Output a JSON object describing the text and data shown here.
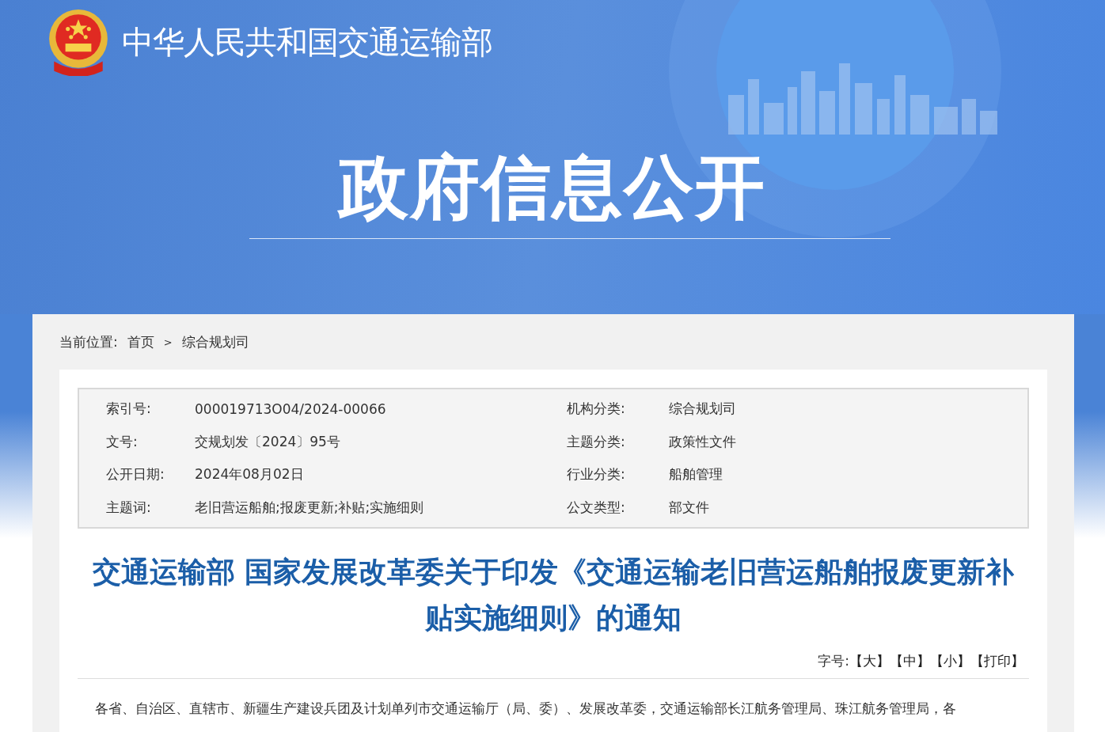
{
  "header": {
    "ministry": "中华人民共和国交通运输部",
    "banner_title": "政府信息公开"
  },
  "breadcrumb": {
    "label": "当前位置:",
    "items": [
      {
        "text": "首页"
      },
      {
        "text": "综合规划司"
      }
    ],
    "separator": ">"
  },
  "meta": [
    {
      "label": "索引号:",
      "value": "000019713O04/2024-00066"
    },
    {
      "label": "机构分类:",
      "value": "综合规划司"
    },
    {
      "label": "文号:",
      "value": "交规划发〔2024〕95号"
    },
    {
      "label": "主题分类:",
      "value": "政策性文件"
    },
    {
      "label": "公开日期:",
      "value": "2024年08月02日"
    },
    {
      "label": "行业分类:",
      "value": "船舶管理"
    },
    {
      "label": "主题词:",
      "value": "老旧营运船舶;报废更新;补贴;实施细则"
    },
    {
      "label": "公文类型:",
      "value": "部文件"
    }
  ],
  "article": {
    "title": "交通运输部 国家发展改革委关于印发《交通运输老旧营运船舶报废更新补贴实施细则》的通知",
    "font_size": {
      "label": "字号:",
      "options": [
        {
          "text": "【大】"
        },
        {
          "text": "【中】"
        },
        {
          "text": "【小】"
        },
        {
          "text": "【打印】"
        }
      ]
    },
    "body": "各省、自治区、直辖市、新疆生产建设兵团及计划单列市交通运输厅（局、委）、发展改革委，交通运输部长江航务管理局、珠江航务管理局，各"
  }
}
